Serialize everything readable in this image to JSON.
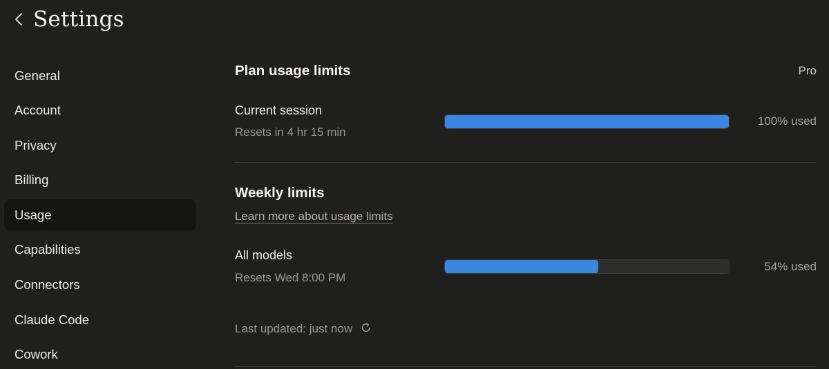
{
  "header": {
    "title": "Settings",
    "back_icon": "chevron-left-icon"
  },
  "sidebar": {
    "items": [
      {
        "label": "General",
        "active": false
      },
      {
        "label": "Account",
        "active": false
      },
      {
        "label": "Privacy",
        "active": false
      },
      {
        "label": "Billing",
        "active": false
      },
      {
        "label": "Usage",
        "active": true
      },
      {
        "label": "Capabilities",
        "active": false
      },
      {
        "label": "Connectors",
        "active": false
      },
      {
        "label": "Claude Code",
        "active": false
      },
      {
        "label": "Cowork",
        "active": false
      }
    ]
  },
  "plan_usage": {
    "title": "Plan usage limits",
    "plan_name": "Pro",
    "current_session": {
      "label": "Current session",
      "reset_text": "Resets in 4 hr 15 min",
      "percent_used": 100,
      "usage_text": "100% used"
    }
  },
  "weekly_limits": {
    "title": "Weekly limits",
    "learn_more_link": "Learn more about usage limits",
    "all_models": {
      "label": "All models",
      "reset_text": "Resets Wed 8:00 PM",
      "percent_used": 54,
      "usage_text": "54% used"
    },
    "last_updated": "Last updated: just now",
    "refresh_icon": "refresh-icon"
  },
  "colors": {
    "background": "#1f1f1e",
    "active_sidebar_bg": "#141413",
    "progress_fill": "#3a86e0",
    "progress_track": "#2d2d2b"
  }
}
